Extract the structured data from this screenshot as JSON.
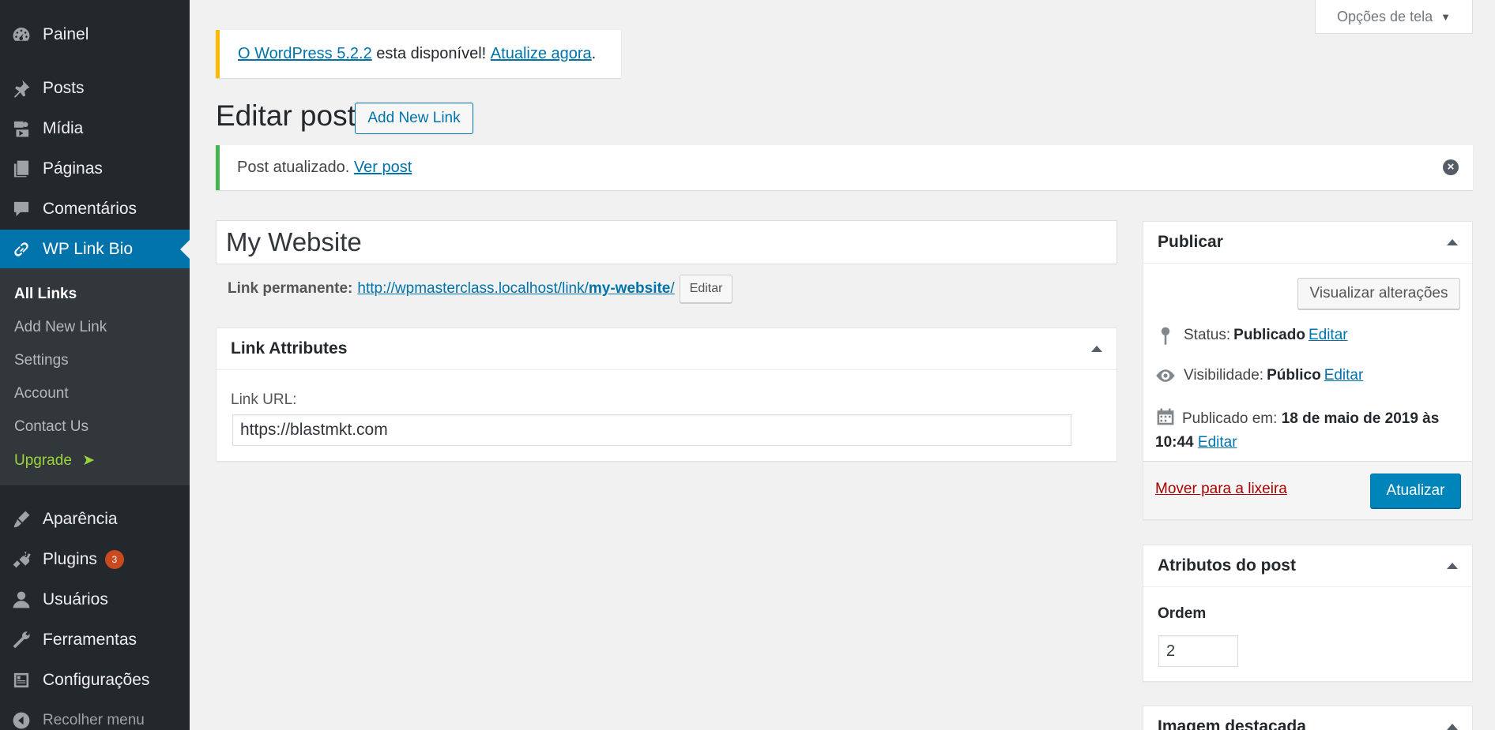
{
  "sidebar": {
    "items": [
      {
        "label": "Painel",
        "icon": "dashboard-icon"
      },
      {
        "label": "Posts",
        "icon": "pin-icon"
      },
      {
        "label": "Mídia",
        "icon": "media-icon"
      },
      {
        "label": "Páginas",
        "icon": "pages-icon"
      },
      {
        "label": "Comentários",
        "icon": "comments-icon"
      },
      {
        "label": "WP Link Bio",
        "icon": "link-icon",
        "active": true
      },
      {
        "label": "Aparência",
        "icon": "appearance-icon"
      },
      {
        "label": "Plugins",
        "icon": "plugins-icon",
        "badge": "3"
      },
      {
        "label": "Usuários",
        "icon": "users-icon"
      },
      {
        "label": "Ferramentas",
        "icon": "tools-icon"
      },
      {
        "label": "Configurações",
        "icon": "settings-icon"
      },
      {
        "label": "Recolher menu",
        "icon": "collapse-icon"
      }
    ],
    "submenu": [
      {
        "label": "All Links",
        "current": true
      },
      {
        "label": "Add New Link"
      },
      {
        "label": "Settings"
      },
      {
        "label": "Account"
      },
      {
        "label": "Contact Us"
      },
      {
        "label": "Upgrade",
        "arrow": "➤"
      }
    ]
  },
  "screen_options": {
    "label": "Opções de tela",
    "arrow": "▼"
  },
  "update_nag": {
    "link1": "O WordPress 5.2.2",
    "text": " esta disponível! ",
    "link2": "Atualize agora",
    "end": "."
  },
  "page": {
    "title": "Editar post",
    "add_new": "Add New Link"
  },
  "success_notice": {
    "text": "Post atualizado. ",
    "link": "Ver post"
  },
  "post": {
    "title": "My Website",
    "permalink_label": "Link permanente:",
    "permalink_base": "http://wpmasterclass.localhost/link/",
    "permalink_slug": "my-website",
    "permalink_end": "/",
    "permalink_edit": "Editar"
  },
  "link_attributes": {
    "title": "Link Attributes",
    "url_label": "Link URL:",
    "url_value": "https://blastmkt.com"
  },
  "publish": {
    "title": "Publicar",
    "preview_btn": "Visualizar alterações",
    "status_label": "Status:",
    "status_value": "Publicado",
    "visibility_label": "Visibilidade:",
    "visibility_value": "Público",
    "published_label": "Publicado em:",
    "published_value": "18 de maio de 2019 às 10:44",
    "edit": "Editar",
    "trash": "Mover para a lixeira",
    "update_btn": "Atualizar"
  },
  "post_attributes": {
    "title": "Atributos do post",
    "order_label": "Ordem",
    "order_value": "2"
  },
  "featured_image": {
    "title": "Imagem destacada"
  },
  "colors": {
    "sidebar": "#23282d",
    "accent": "#0073aa",
    "success": "#46b450",
    "warning": "#ffb900",
    "upgrade": "#9ad53a"
  }
}
